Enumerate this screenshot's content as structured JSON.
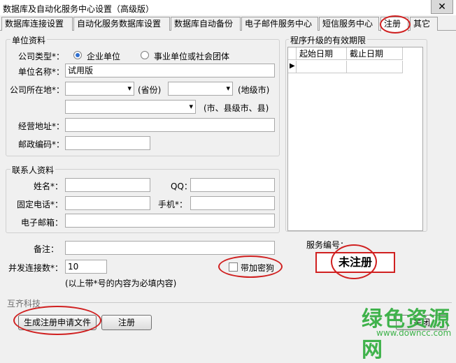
{
  "window": {
    "title": "数据库及自动化服务中心设置（高级版）",
    "close_label": "✕"
  },
  "tabs": [
    "数据库连接设置",
    "自动化服务数据库设置",
    "数据库自动备份",
    "电子邮件服务中心",
    "短信服务中心",
    "注册",
    "其它"
  ],
  "unit": {
    "group_label": "单位资料",
    "company_type_label": "公司类型*：",
    "company_type_options": [
      "企业单位",
      "事业单位或社会团体"
    ],
    "company_name_label": "单位名称*：",
    "company_name_value": "试用版",
    "location_label": "公司所在地*：",
    "province_suffix": "(省份)",
    "city_suffix": "(地级市)",
    "county_suffix": "(市、县级市、县)",
    "address_label": "经营地址*：",
    "postcode_label": "邮政编码*："
  },
  "contact": {
    "group_label": "联系人资料",
    "name_label": "姓名*：",
    "qq_label": "QQ：",
    "phone_label": "固定电话*：",
    "mobile_label": "手机*：",
    "email_label": "电子邮箱："
  },
  "remark_label": "备注：",
  "concurrency": {
    "label": "并发连接数*：",
    "value": "10"
  },
  "note": "(以上带*号的内容为必填内容)",
  "dongle_label": "带加密狗",
  "validity": {
    "group_label": "程序升级的有效期限",
    "col_start": "起始日期",
    "col_end": "截止日期"
  },
  "service": {
    "label": "服务编号：",
    "status": "未注册"
  },
  "footer": {
    "company": "互齐科技",
    "generate_button": "生成注册申请文件",
    "register_button": "注册",
    "close_button": "关闭"
  },
  "watermark": {
    "brand": "绿色资源网",
    "url": "www.downcc.com"
  }
}
